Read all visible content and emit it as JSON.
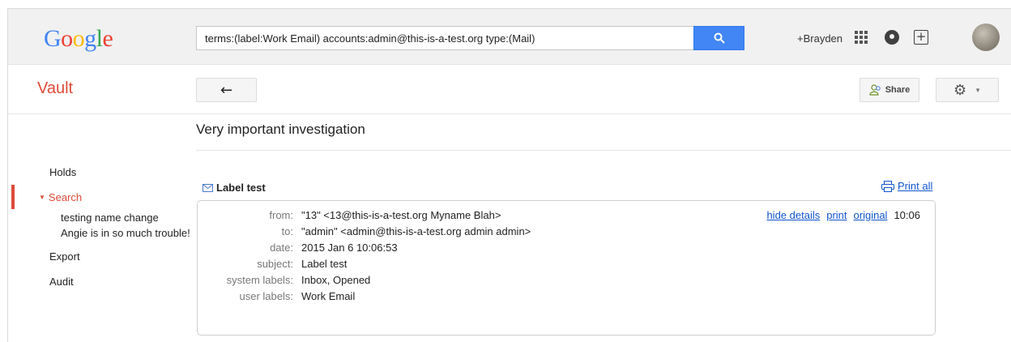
{
  "header": {
    "logo_letters": [
      {
        "ch": "G",
        "color": "#4285f4"
      },
      {
        "ch": "o",
        "color": "#ea4335"
      },
      {
        "ch": "o",
        "color": "#fbbc05"
      },
      {
        "ch": "g",
        "color": "#4285f4"
      },
      {
        "ch": "l",
        "color": "#34a853"
      },
      {
        "ch": "e",
        "color": "#ea4335"
      }
    ],
    "search_query": "terms:(label:Work Email) accounts:admin@this-is-a-test.org type:(Mail)",
    "user_link": "+Brayden",
    "icons": [
      "search-icon",
      "apps-icon",
      "notifications-icon",
      "share-plus-icon",
      "avatar"
    ]
  },
  "toolbar": {
    "product_name": "Vault",
    "back_glyph": "←",
    "share_label": "Share",
    "settings_glyph": "⚙",
    "caret_glyph": "▼"
  },
  "matter": {
    "title": "Very important investigation"
  },
  "nav": {
    "holds": "Holds",
    "search": "Search",
    "saved_searches": [
      "testing name change",
      "Angie is in so much trouble!"
    ],
    "export": "Export",
    "audit": "Audit",
    "active_color": "#dd4b39"
  },
  "message": {
    "subject_header": "Label test",
    "print_all": "Print all",
    "actions": {
      "hide_details": "hide details",
      "print": "print",
      "original": "original",
      "time": "10:06"
    },
    "fields": [
      {
        "label": "from:",
        "value": "\"13\" <13@this-is-a-test.org Myname Blah>"
      },
      {
        "label": "to:",
        "value": "\"admin\" <admin@this-is-a-test.org admin admin>"
      },
      {
        "label": "date:",
        "value": "2015 Jan 6 10:06:53"
      },
      {
        "label": "subject:",
        "value": "Label test"
      },
      {
        "label": "system labels:",
        "value": "Inbox, Opened"
      },
      {
        "label": "user labels:",
        "value": "Work Email"
      }
    ]
  },
  "colors": {
    "accent_blue": "#4285f4",
    "link_blue": "#1155cc",
    "vault_red": "#dd4b39"
  }
}
